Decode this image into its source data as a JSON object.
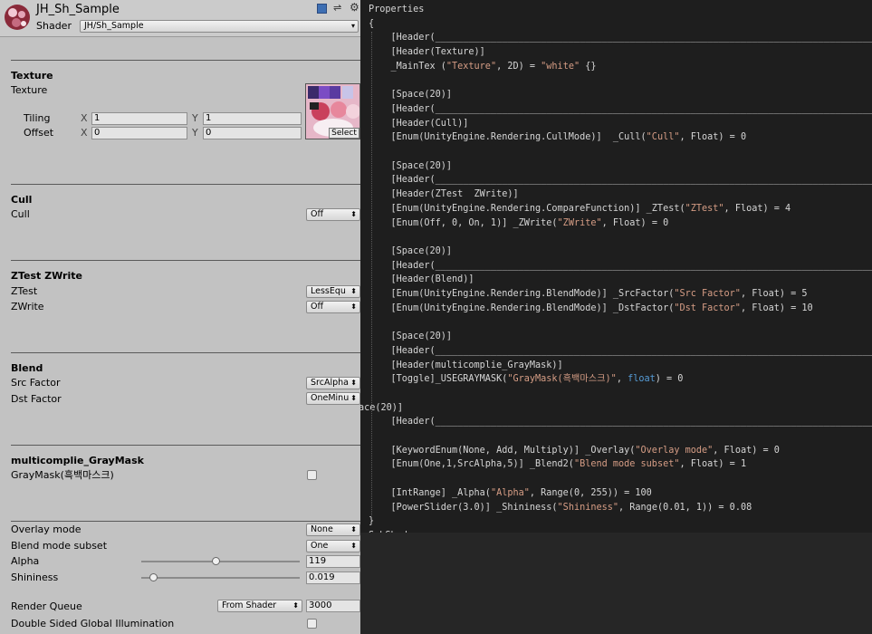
{
  "inspector": {
    "title": "JH_Sh_Sample",
    "shader_label": "Shader",
    "shader_value": "JH/Sh_Sample",
    "texture": {
      "header": "Texture",
      "label": "Texture",
      "tiling_label": "Tiling",
      "offset_label": "Offset",
      "x_label": "X",
      "y_label": "Y",
      "tiling_x": "1",
      "tiling_y": "1",
      "offset_x": "0",
      "offset_y": "0",
      "select_label": "Select"
    },
    "cull": {
      "header": "Cull",
      "label": "Cull",
      "value": "Off"
    },
    "ztest": {
      "header": "ZTest  ZWrite",
      "ztest_label": "ZTest",
      "ztest_value": "LessEqu",
      "zwrite_label": "ZWrite",
      "zwrite_value": "Off"
    },
    "blend": {
      "header": "Blend",
      "src_label": "Src Factor",
      "src_value": "SrcAlpha",
      "dst_label": "Dst Factor",
      "dst_value": "OneMinu"
    },
    "graymask": {
      "header": "multicomplie_GrayMask",
      "label": "GrayMask(흑백마스크)",
      "checked": false
    },
    "overlay": {
      "label": "Overlay mode",
      "value": "None"
    },
    "blend2": {
      "label": "Blend mode subset",
      "value": "One"
    },
    "alpha": {
      "label": "Alpha",
      "value": "119",
      "fraction": 0.467
    },
    "shininess": {
      "label": "Shininess",
      "value": "0.019",
      "fraction": 0.019
    },
    "render_queue": {
      "label": "Render Queue",
      "mode": "From Shader",
      "value": "3000"
    },
    "double_sided": {
      "label": "Double Sided Global Illumination",
      "checked": false
    }
  },
  "code": {
    "lines": [
      "Properties",
      "{",
      "    [Header(___________________________________________________________________________________________)]",
      "    [Header(Texture)]",
      "    _MainTex (\"Texture\", 2D) = \"white\" {}",
      "",
      "    [Space(20)]",
      "    [Header(___________________________________________________________________________________________)]",
      "    [Header(Cull)]",
      "    [Enum(UnityEngine.Rendering.CullMode)]  _Cull(\"Cull\", Float) = 0",
      "",
      "    [Space(20)]",
      "    [Header(___________________________________________________________________________________________)]",
      "    [Header(ZTest  ZWrite)]",
      "    [Enum(UnityEngine.Rendering.CompareFunction)] _ZTest(\"ZTest\", Float) = 4",
      "    [Enum(Off, 0, On, 1)] _ZWrite(\"ZWrite\", Float) = 0",
      "",
      "    [Space(20)]",
      "    [Header(___________________________________________________________________________________________)]",
      "    [Header(Blend)]",
      "    [Enum(UnityEngine.Rendering.BlendMode)] _SrcFactor(\"Src Factor\", Float) = 5",
      "    [Enum(UnityEngine.Rendering.BlendMode)] _DstFactor(\"Dst Factor\", Float) = 10",
      "",
      "    [Space(20)]",
      "    [Header(___________________________________________________________________________________________)]",
      "    [Header(multicomplie_GrayMask)]",
      "    [Toggle]_USEGRAYMASK(\"GrayMask(흑백마스크)\", float) = 0",
      "",
      "ace(20)]",
      "    [Header(___________________________________________________________________________________________)]",
      "",
      "    [KeywordEnum(None, Add, Multiply)] _Overlay(\"Overlay mode\", Float) = 0",
      "    [Enum(One,1,SrcAlpha,5)] _Blend2(\"Blend mode subset\", Float) = 1",
      "",
      "    [IntRange] _Alpha(\"Alpha\", Range(0, 255)) = 100",
      "    [PowerSlider(3.0)] _Shininess(\"Shininess\", Range(0.01, 1)) = 0.08",
      "}",
      "SubShader"
    ],
    "text_color": "#d6d6d6",
    "string_color": "#d69d85",
    "keyword_color": "#569cd6"
  }
}
